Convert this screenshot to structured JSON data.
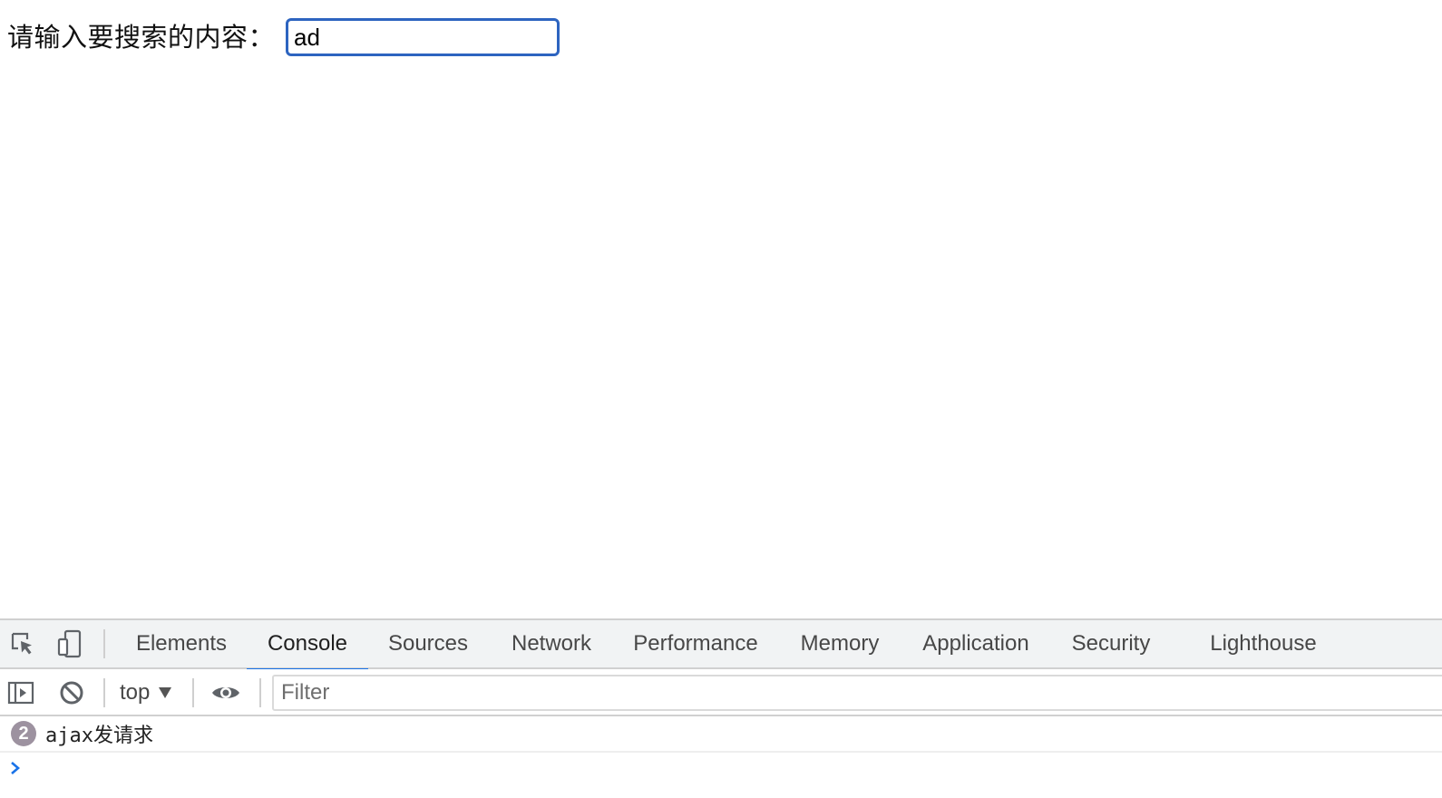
{
  "page": {
    "search_label": "请输入要搜索的内容：",
    "search_value": "ad"
  },
  "devtools": {
    "tabs": [
      {
        "label": "Elements"
      },
      {
        "label": "Console",
        "active": true
      },
      {
        "label": "Sources"
      },
      {
        "label": "Network"
      },
      {
        "label": "Performance"
      },
      {
        "label": "Memory"
      },
      {
        "label": "Application"
      },
      {
        "label": "Security"
      },
      {
        "label": "Lighthouse"
      }
    ],
    "toolbar": {
      "context": "top",
      "filter_placeholder": "Filter"
    },
    "console": {
      "messages": [
        {
          "count": "2",
          "text": "ajax发请求"
        }
      ]
    },
    "colors": {
      "accent": "#1a73e8",
      "badge": "#9d92a0",
      "prompt": "#1a73e8"
    },
    "icons": [
      "inspect-element-icon",
      "device-toolbar-icon",
      "sidebar-toggle-icon",
      "clear-console-icon",
      "eye-icon",
      "prompt-chevron-icon"
    ]
  }
}
